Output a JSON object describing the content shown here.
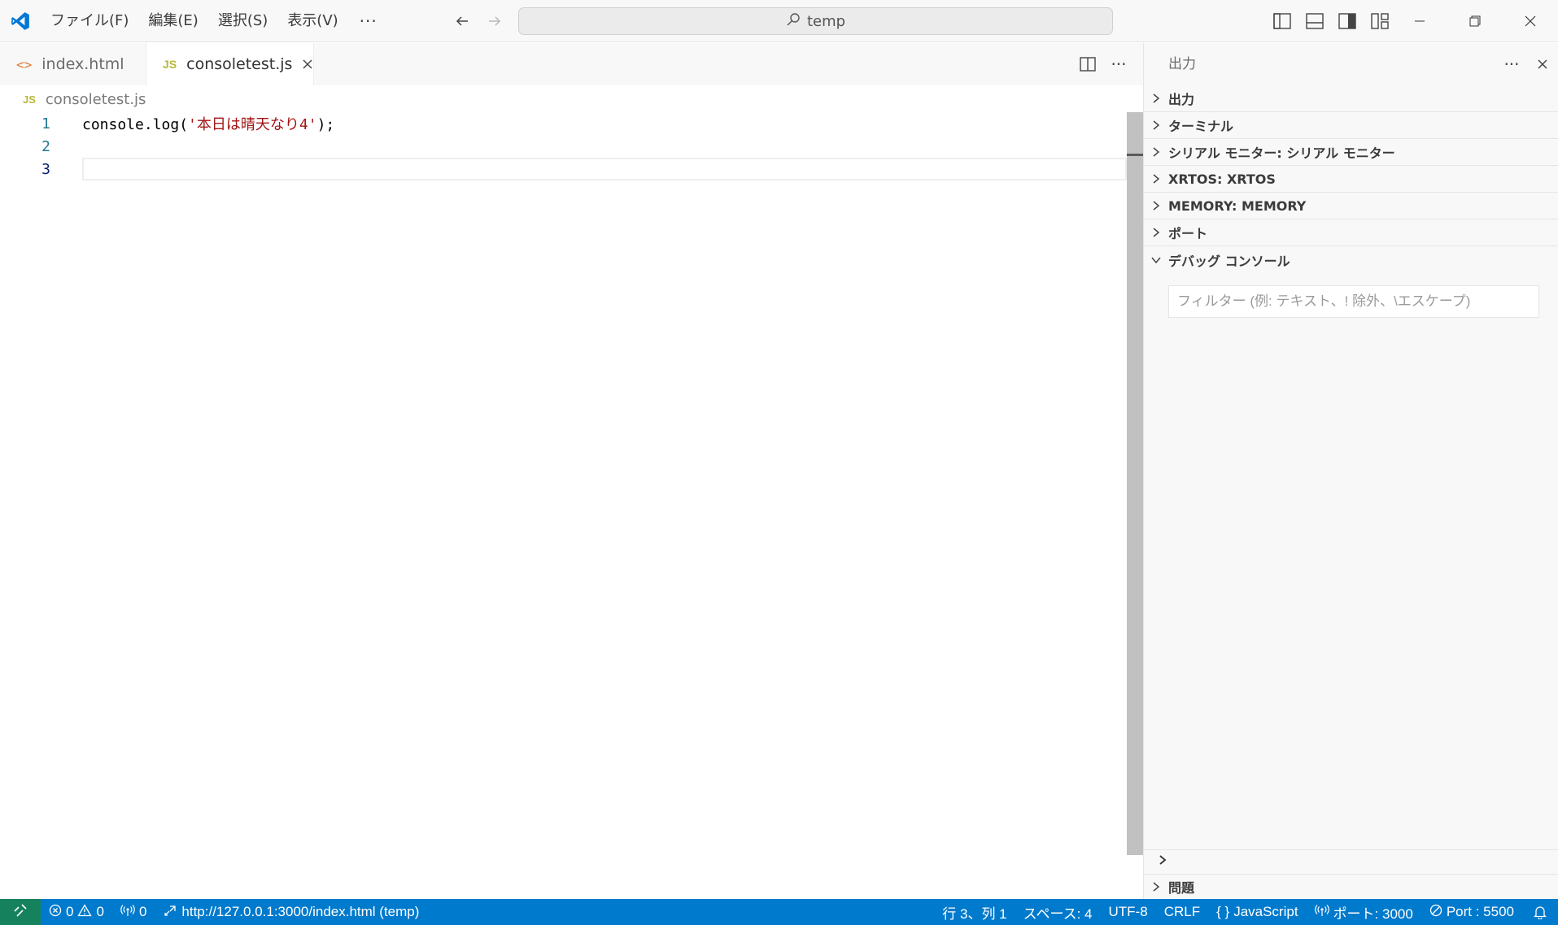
{
  "titlebar": {
    "menu": [
      "ファイル(F)",
      "編集(E)",
      "選択(S)",
      "表示(V)"
    ],
    "more": "···",
    "search_text": "temp"
  },
  "tabs": [
    {
      "label": "index.html",
      "icon": "html-file-icon",
      "active": false
    },
    {
      "label": "consoletest.js",
      "icon": "js-file-icon",
      "active": true
    }
  ],
  "breadcrumb": {
    "file": "consoletest.js",
    "badge": "JS"
  },
  "editor": {
    "lines": [
      {
        "num": "1",
        "prefix": "console.log(",
        "string": "'本日は晴天なり4'",
        "suffix": ");"
      },
      {
        "num": "2"
      },
      {
        "num": "3"
      }
    ]
  },
  "panel": {
    "title": "出力",
    "sections": [
      "出力",
      "ターミナル",
      "シリアル モニター: シリアル モニター",
      "XRTOS: XRTOS",
      "MEMORY: MEMORY",
      "ポート",
      "デバッグ コンソール"
    ],
    "filter_placeholder": "フィルター (例: テキスト、! 除外、\\エスケープ)",
    "problems": "問題"
  },
  "statusbar": {
    "errors": "0",
    "warnings": "0",
    "ports_forwarded": "0",
    "live_url": "http://127.0.0.1:3000/index.html (temp)",
    "position": "行 3、列 1",
    "spaces": "スペース: 4",
    "encoding": "UTF-8",
    "eol": "CRLF",
    "language": "JavaScript",
    "language_prefix": "{ }",
    "port": "ポート: 3000",
    "live_port": "Port : 5500"
  },
  "colors": {
    "statusbar": "#007acc",
    "remote": "#16825d",
    "string": "#a31515",
    "line_number": "#237893"
  }
}
